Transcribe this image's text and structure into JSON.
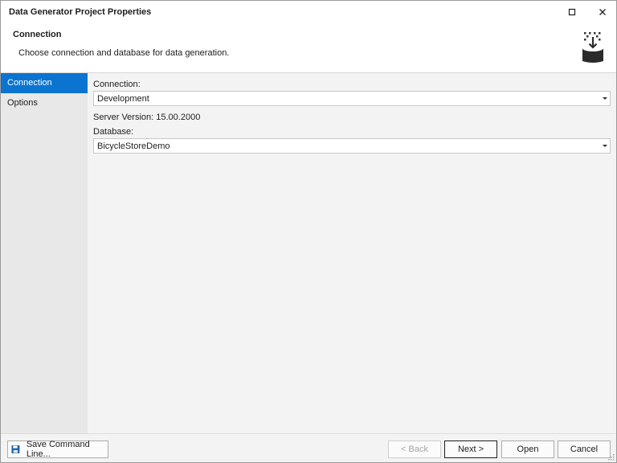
{
  "window": {
    "title": "Data Generator Project Properties"
  },
  "header": {
    "title": "Connection",
    "description": "Choose connection and database for data generation."
  },
  "sidebar": {
    "items": [
      {
        "label": "Connection",
        "active": true
      },
      {
        "label": "Options",
        "active": false
      }
    ]
  },
  "form": {
    "connection_label": "Connection:",
    "connection_value": "Development",
    "server_version_text": "Server Version: 15.00.2000",
    "database_label": "Database:",
    "database_value": "BicycleStoreDemo"
  },
  "footer": {
    "save_command_line_label": "Save Command Line...",
    "back_label": "< Back",
    "next_label": "Next >",
    "open_label": "Open",
    "cancel_label": "Cancel"
  },
  "colors": {
    "accent": "#0a74d0",
    "sidebar_bg": "#e8e8e8",
    "content_bg": "#f3f3f3"
  },
  "icons": {
    "header": "database-generate-icon",
    "maximize": "maximize-icon",
    "close": "close-icon",
    "save": "floppy-disk-icon",
    "dropdown": "chevron-down-icon"
  }
}
